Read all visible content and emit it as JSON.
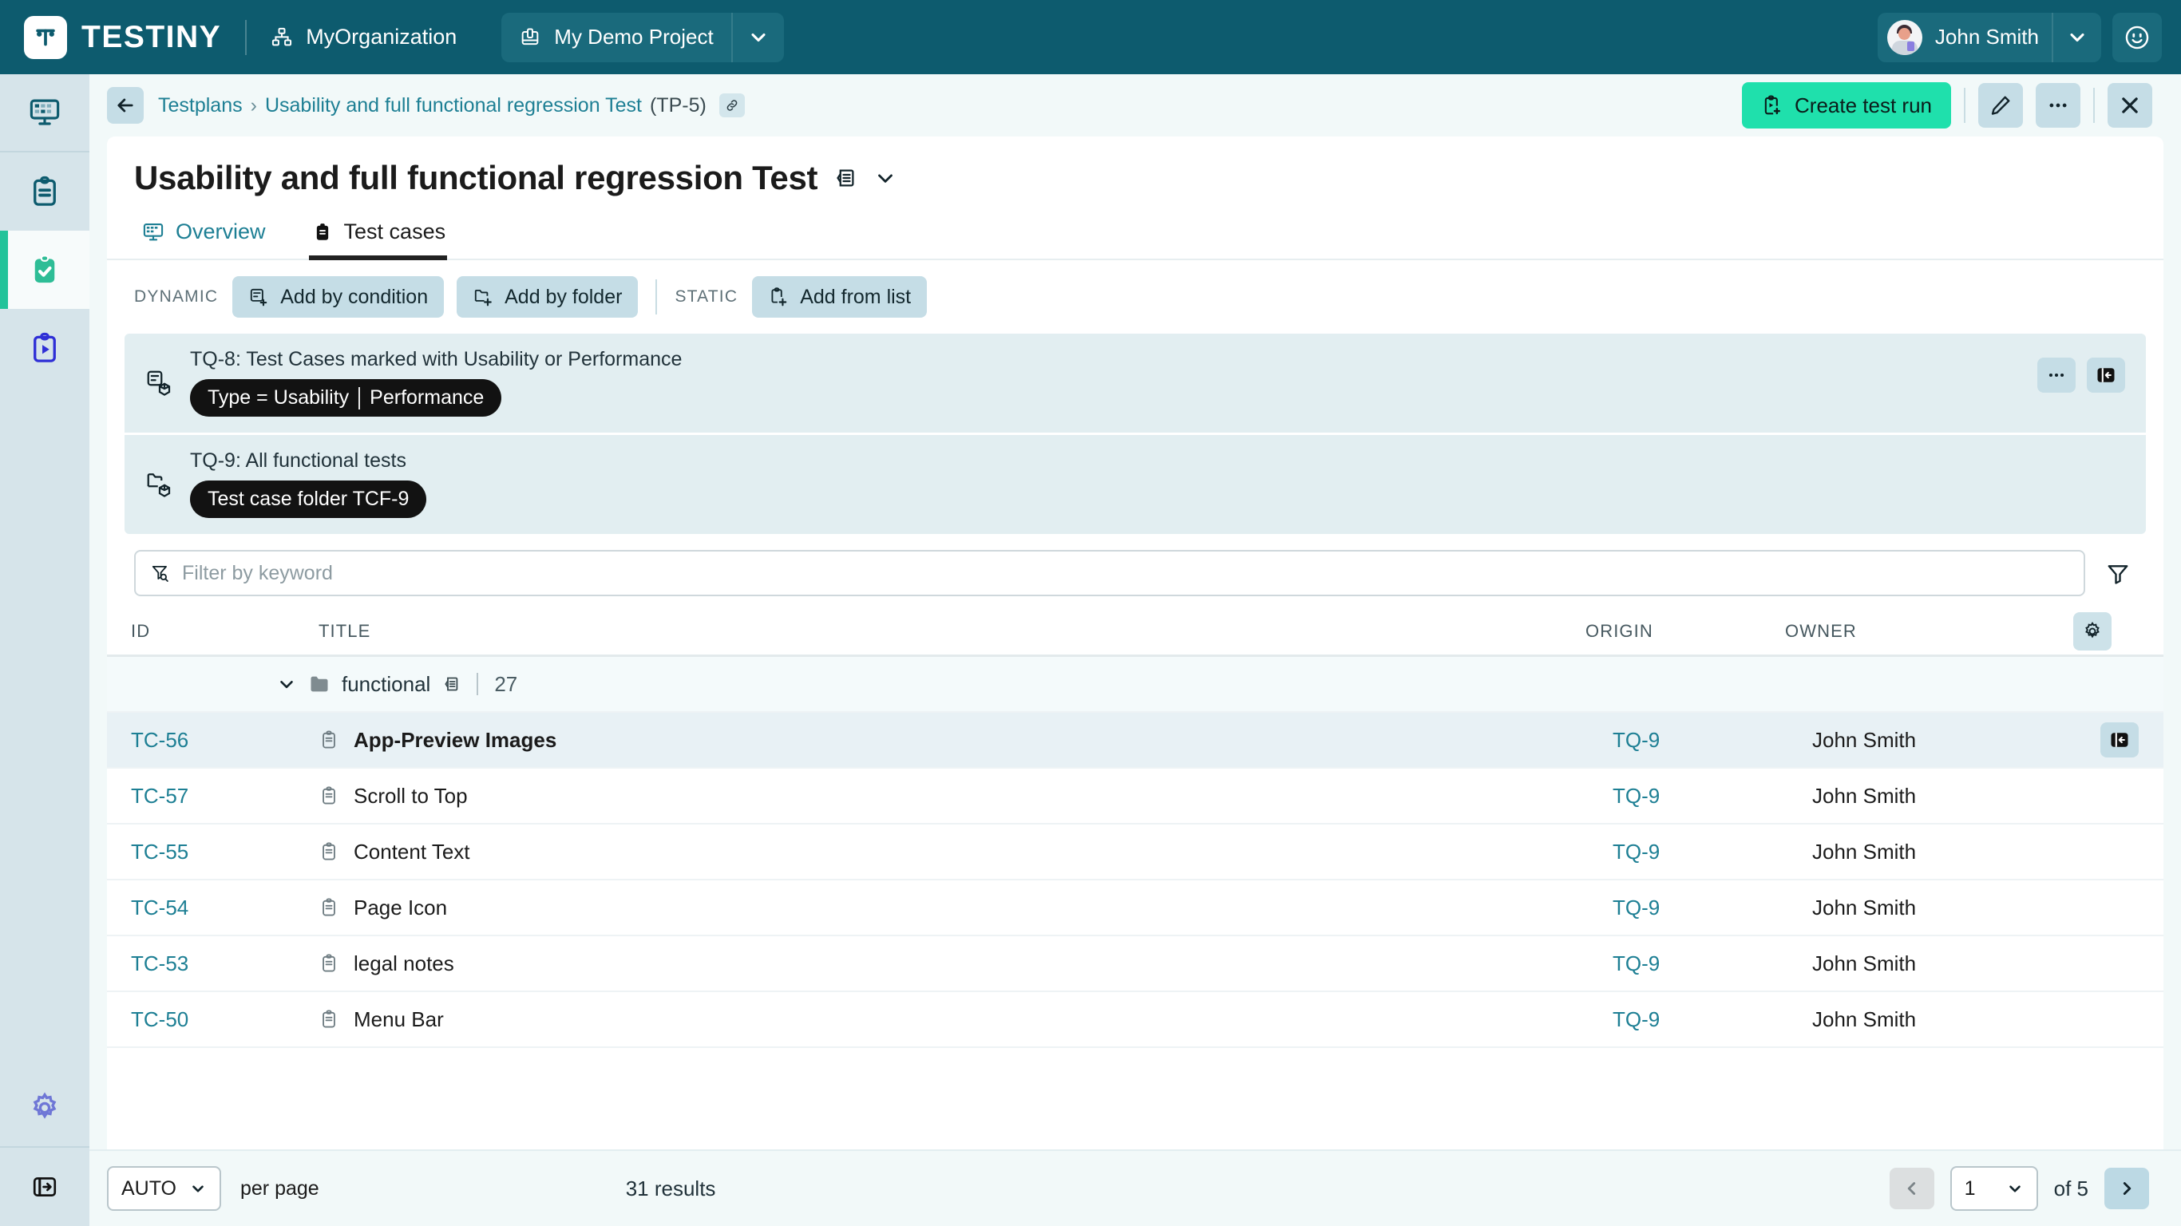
{
  "topbar": {
    "brand_name": "TESTINY",
    "org_name": "MyOrganization",
    "project_name": "My Demo Project",
    "user_name": "John Smith",
    "icons": {
      "org": "org-chart-icon",
      "project": "project-icon",
      "caret": "chevron-down-icon",
      "smiley": "smiley-icon"
    }
  },
  "rail": {
    "items": [
      {
        "name": "dashboard",
        "icon": "dashboard-icon",
        "active": false
      },
      {
        "name": "test-cases",
        "icon": "clipboard-icon",
        "active": false
      },
      {
        "name": "test-plans",
        "icon": "clipboard-check-icon",
        "active": true
      },
      {
        "name": "test-runs",
        "icon": "clipboard-play-icon",
        "active": false
      }
    ],
    "bottom": [
      {
        "name": "settings",
        "icon": "gear-icon"
      },
      {
        "name": "collapse-sidebar",
        "icon": "panel-collapse-icon"
      }
    ]
  },
  "breadcrumb": {
    "back_label": "back",
    "root": "Testplans",
    "separator": "›",
    "current": "Usability and full functional regression Test",
    "current_id": "(TP-5)",
    "link_icon": "link-icon"
  },
  "header_actions": {
    "create_run_label": "Create test run",
    "create_run_icon": "clipboard-play-plus-icon",
    "edit_icon": "pencil-icon",
    "more_icon": "more-horizontal-icon",
    "close_icon": "close-icon",
    "accent_color": "#1fe0ac"
  },
  "page": {
    "title": "Usability and full functional regression Test",
    "title_doc_icon": "description-icon",
    "title_caret_icon": "chevron-down-icon"
  },
  "tabs": [
    {
      "label": "Overview",
      "icon": "dashboard-icon",
      "active": false
    },
    {
      "label": "Test cases",
      "icon": "clipboard-icon",
      "active": true
    }
  ],
  "addbar": {
    "dynamic_label": "DYNAMIC",
    "static_label": "STATIC",
    "buttons": [
      {
        "label": "Add by condition",
        "icon": "condition-add-icon",
        "group": "dynamic"
      },
      {
        "label": "Add by folder",
        "icon": "folder-add-icon",
        "group": "dynamic"
      },
      {
        "label": "Add from list",
        "icon": "clipboard-add-icon",
        "group": "static"
      }
    ]
  },
  "queries": [
    {
      "title": "TQ-8: Test Cases marked with Usability or Performance",
      "pill_left": "Type = Usability",
      "pill_right": "Performance",
      "icon": "condition-query-icon",
      "has_actions": true,
      "more_icon": "more-horizontal-icon",
      "open_icon": "open-panel-icon"
    },
    {
      "title": "TQ-9: All functional tests",
      "pill_left": "Test case folder TCF-9",
      "pill_right": "",
      "icon": "folder-query-icon",
      "has_actions": false
    }
  ],
  "filter": {
    "placeholder": "Filter by keyword",
    "value": "",
    "icon": "filter-search-icon",
    "toggle_icon": "filter-icon"
  },
  "table": {
    "columns": [
      "ID",
      "TITLE",
      "ORIGIN",
      "OWNER"
    ],
    "settings_icon": "gear-icon",
    "folder_group": {
      "expand_icon": "chevron-down-icon",
      "folder_icon": "folder-icon",
      "name": "functional",
      "doc_icon": "description-icon",
      "count": "27"
    },
    "rows": [
      {
        "id": "TC-56",
        "icon": "clipboard-icon",
        "title": "App-Preview Images",
        "origin": "TQ-9",
        "owner": "John Smith",
        "selected": true,
        "action_icon": "open-panel-icon"
      },
      {
        "id": "TC-57",
        "icon": "clipboard-icon",
        "title": "Scroll to Top",
        "origin": "TQ-9",
        "owner": "John Smith",
        "selected": false
      },
      {
        "id": "TC-55",
        "icon": "clipboard-icon",
        "title": "Content Text",
        "origin": "TQ-9",
        "owner": "John Smith",
        "selected": false
      },
      {
        "id": "TC-54",
        "icon": "clipboard-icon",
        "title": "Page Icon",
        "origin": "TQ-9",
        "owner": "John Smith",
        "selected": false
      },
      {
        "id": "TC-53",
        "icon": "clipboard-icon",
        "title": "legal notes",
        "origin": "TQ-9",
        "owner": "John Smith",
        "selected": false
      },
      {
        "id": "TC-50",
        "icon": "clipboard-icon",
        "title": "Menu Bar",
        "origin": "TQ-9",
        "owner": "John Smith",
        "selected": false
      }
    ]
  },
  "footer": {
    "per_page_value": "AUTO",
    "per_page_label": "per page",
    "results": "31 results",
    "prev_icon": "chevron-left-icon",
    "next_icon": "chevron-right-icon",
    "page_value": "1",
    "of_label": "of 5"
  }
}
